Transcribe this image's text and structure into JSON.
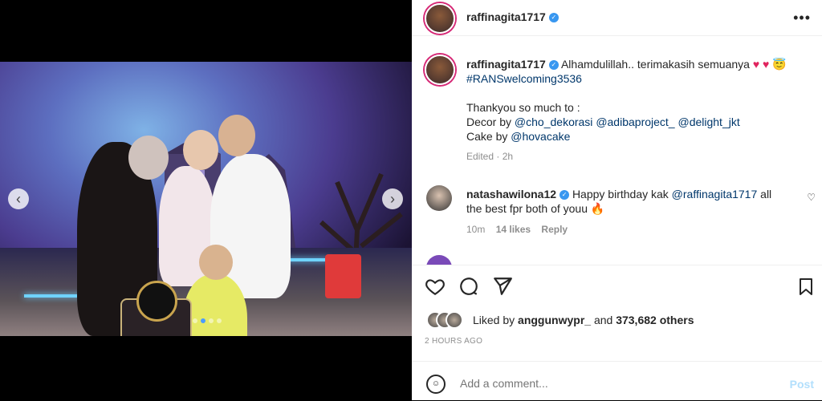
{
  "post": {
    "username": "raffinagita1717",
    "more_icon": "more-horizontal-icon"
  },
  "caption": {
    "username": "raffinagita1717",
    "text": "Alhamdulillah.. terimakasih semuanya",
    "hashtag": "#RANSwelcoming3536",
    "thanks_line": "Thankyou so much to :",
    "decor_label": "Decor by",
    "decor_mentions": [
      "@cho_dekorasi",
      "@adibaproject_",
      "@delight_jkt"
    ],
    "cake_label": "Cake by",
    "cake_mention": "@hovacake",
    "edited": "Edited · 2h"
  },
  "comment": {
    "username": "natashawilona12",
    "text_before": "Happy birthday kak",
    "mention": "@raffinagita1717",
    "text_after": "all the best fpr both of youu",
    "time": "10m",
    "likes": "14 likes",
    "reply": "Reply"
  },
  "likes": {
    "prefix": "Liked by",
    "user": "anggunwypr_",
    "middle": "and",
    "count": "373,682 others"
  },
  "timestamp": "2 HOURS AGO",
  "comment_box": {
    "placeholder": "Add a comment...",
    "post_label": "Post"
  },
  "carousel": {
    "slide_count": 4,
    "active_index": 1
  },
  "colors": {
    "verified": "#3897f0",
    "link": "#00376b",
    "post_disabled": "#b2dffc"
  }
}
